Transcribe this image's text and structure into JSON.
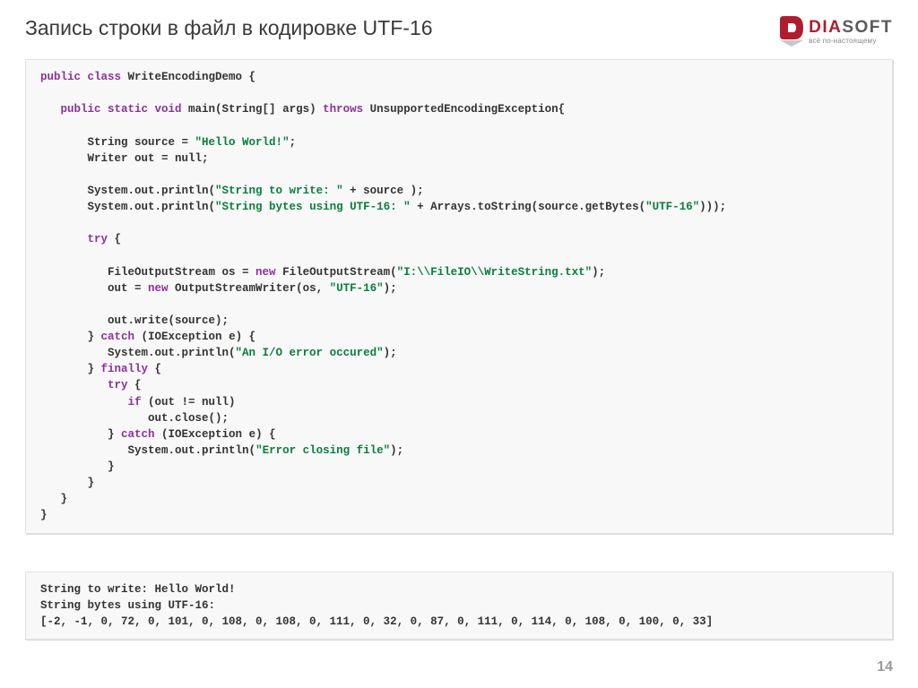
{
  "header": {
    "title": "Запись строки в файл в кодировке UTF-16",
    "logo": {
      "dia": "DIA",
      "soft": "SOFT",
      "tagline": "всё по-настоящему"
    }
  },
  "code": {
    "l1_kw": "public class ",
    "l1_cls": "WriteEncodingDemo {",
    "l2_kw": "public static void ",
    "l2_m": "main(String[] args) ",
    "l2_th": "throws ",
    "l2_ex": "UnsupportedEncodingException{",
    "l3_p1": "String source = ",
    "l3_s": "\"Hello World!\"",
    "l3_p2": ";",
    "l4": "Writer out = null;",
    "l5_p1": "System.out.println(",
    "l5_s": "\"String to write: \"",
    "l5_p2": " + source );",
    "l6_p1": "System.out.println(",
    "l6_s1": "\"String bytes using UTF-16: \"",
    "l6_p2": " + Arrays.toString(source.getBytes(",
    "l6_s2": "\"UTF-16\"",
    "l6_p3": ")));",
    "l7_kw": "try ",
    "l7_b": "{",
    "l8_p1": "FileOutputStream os = ",
    "l8_kw": "new ",
    "l8_p2": "FileOutputStream(",
    "l8_s": "\"I:\\\\FileIO\\\\WriteString.txt\"",
    "l8_p3": ");",
    "l9_p1": "out = ",
    "l9_kw": "new ",
    "l9_p2": "OutputStreamWriter(os, ",
    "l9_s": "\"UTF-16\"",
    "l9_p3": ");",
    "l10": "out.write(source);",
    "l11_b1": "} ",
    "l11_kw": "catch ",
    "l11_p": "(IOException e) {",
    "l12_p1": "System.out.println(",
    "l12_s": "\"An I/O error occured\"",
    "l12_p2": ");",
    "l13_b1": "} ",
    "l13_kw": "finally ",
    "l13_b2": "{",
    "l14_kw": "try ",
    "l14_b": "{",
    "l15_kw": "if ",
    "l15_p": "(out != null)",
    "l16": "out.close();",
    "l17_b1": "} ",
    "l17_kw": "catch ",
    "l17_p": "(IOException e) {",
    "l18_p1": "System.out.println(",
    "l18_s": "\"Error closing file\"",
    "l18_p2": ");",
    "l19": "}",
    "l20": "}",
    "l21": "}",
    "l22": "}"
  },
  "output": {
    "line1": "String to write: Hello World!",
    "line2": "String bytes using UTF-16:",
    "line3": "[-2, -1, 0, 72, 0, 101, 0, 108, 0, 108, 0, 111, 0, 32, 0, 87, 0, 111, 0, 114, 0, 108, 0, 100, 0, 33]"
  },
  "pageNumber": "14"
}
